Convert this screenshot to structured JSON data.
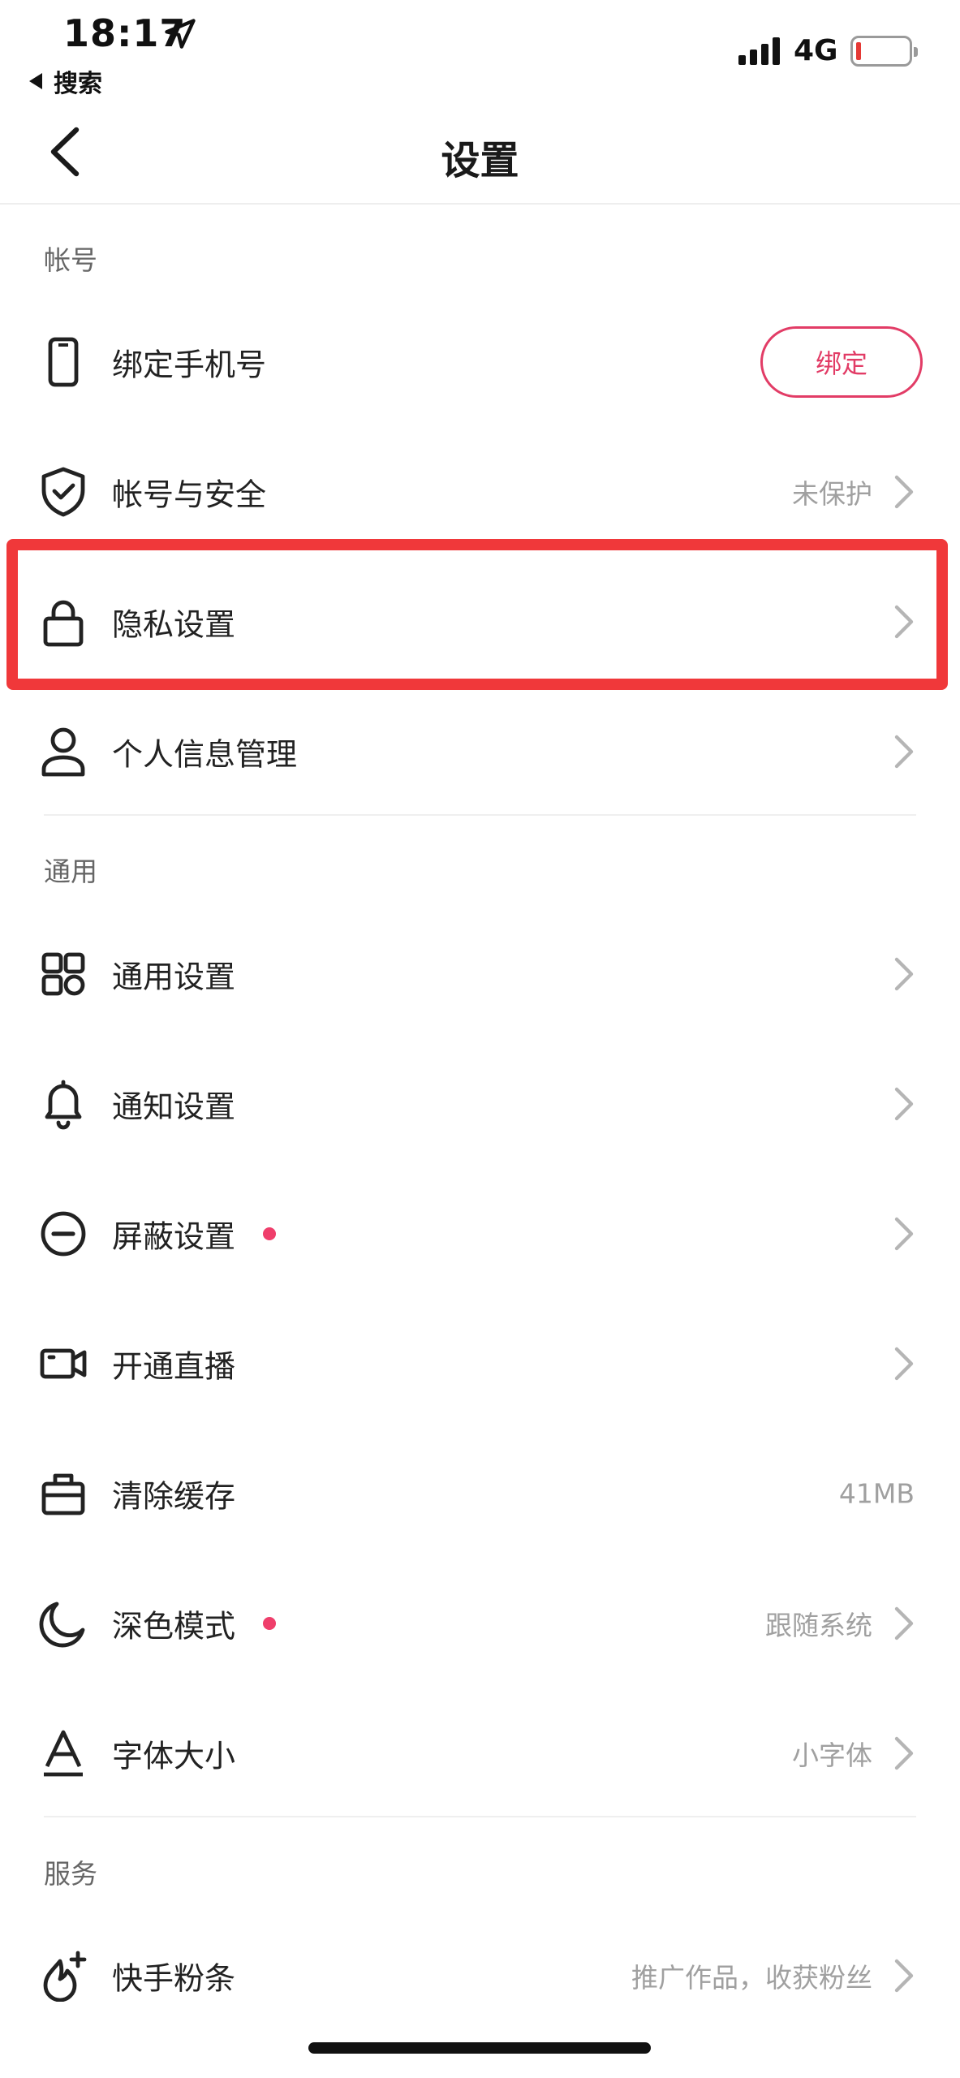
{
  "status_bar": {
    "time": "18:17",
    "back_app": "搜索",
    "network": "4G",
    "battery_color": "#e53935"
  },
  "nav": {
    "title": "设置",
    "back_icon": "chevron-left-icon"
  },
  "sections": {
    "account": {
      "header": "帐号",
      "items": [
        {
          "label": "绑定手机号",
          "icon": "phone-icon",
          "button": "绑定"
        },
        {
          "label": "帐号与安全",
          "icon": "shield-check-icon",
          "value": "未保护"
        },
        {
          "label": "隐私设置",
          "icon": "lock-icon",
          "value": ""
        },
        {
          "label": "个人信息管理",
          "icon": "person-icon",
          "value": ""
        }
      ]
    },
    "general": {
      "header": "通用",
      "items": [
        {
          "label": "通用设置",
          "icon": "grid-icon",
          "value": ""
        },
        {
          "label": "通知设置",
          "icon": "bell-icon",
          "value": ""
        },
        {
          "label": "屏蔽设置",
          "icon": "block-icon",
          "value": "",
          "badge": true
        },
        {
          "label": "开通直播",
          "icon": "video-camera-icon",
          "value": ""
        },
        {
          "label": "清除缓存",
          "icon": "toolbox-icon",
          "value": "41MB"
        },
        {
          "label": "深色模式",
          "icon": "moon-icon",
          "value": "跟随系统",
          "badge": true
        },
        {
          "label": "字体大小",
          "icon": "font-size-icon",
          "value": "小字体"
        }
      ]
    },
    "services": {
      "header": "服务",
      "items": [
        {
          "label": "快手粉条",
          "icon": "flame-plus-icon",
          "value": "推广作品，收获粉丝"
        }
      ]
    }
  },
  "colors": {
    "accent": "#e23c66",
    "badge": "#ef3e6b",
    "highlight_box": "#f0383a"
  }
}
